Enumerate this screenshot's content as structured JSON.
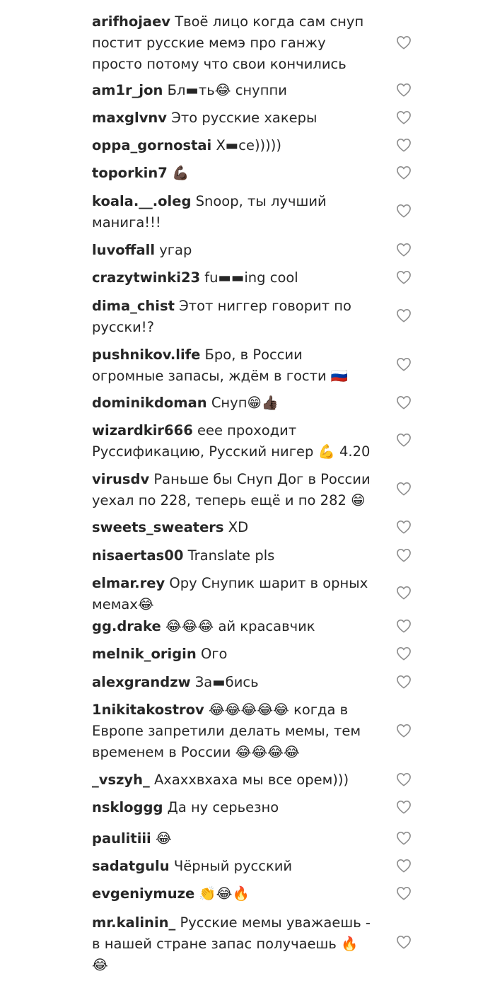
{
  "comments": [
    {
      "username": "arifhojaev",
      "text": "Твоё лицо когда сам снуп постит русские мемэ про ганжу просто потому что свои кончились"
    },
    {
      "username": "am1r_jon",
      "text": "Бл▬ть😂 снуппи"
    },
    {
      "username": "maxglvnv",
      "text": "Это русские хакеры"
    },
    {
      "username": "oppa_gornostai",
      "text": "Х▬се)))))"
    },
    {
      "username": "toporkin7",
      "text": "💪🏿"
    },
    {
      "username": "koala.__.oleg",
      "text": "Snoop, ты лучший манига!!!"
    },
    {
      "username": "luvoffall",
      "text": "угар"
    },
    {
      "username": "crazytwinki23",
      "text": "fu▬▬ing cool"
    },
    {
      "username": "dima_chist",
      "text": "Этот ниггер говорит по русски!?"
    },
    {
      "username": "pushnikov.life",
      "text": "Бро, в России огромные запасы, ждём в гости 🇷🇺"
    },
    {
      "username": "dominikdoman",
      "text": "Снуп😁👍🏿"
    },
    {
      "username": "wizardkir666",
      "text": "еее проходит Руссификацию, Русский нигер 💪 4.20"
    },
    {
      "username": "virusdv",
      "text": "Раньше бы Снуп Дог в России уехал по 228, теперь ещё и по 282 😁"
    },
    {
      "username": "sweets_sweaters",
      "text": "XD"
    },
    {
      "username": "nisaertas00",
      "text": "Translate pls"
    },
    {
      "username": "elmar.rey",
      "text": "Ору Снупик шарит в орных мемах😂"
    },
    {
      "username": "gg.drake",
      "text": "😂😂😂 ай красавчик"
    },
    {
      "username": "melnik_origin",
      "text": "Ого"
    },
    {
      "username": "alexgrandzw",
      "text": "За▬бись"
    },
    {
      "username": "1nikitakostrov",
      "text": "😂😂😂😂😂 когда в Европе запретили делать мемы, тем временем в России 😂😂😂😂"
    },
    {
      "username": "_vszyh_",
      "text": "Ахаххвхаха мы все орем)))"
    },
    {
      "username": "nskloggg",
      "text": "Да ну серьезно"
    },
    {
      "username": "paulitiii",
      "text": "😂"
    },
    {
      "username": "sadatgulu",
      "text": "Чёрный русский"
    },
    {
      "username": "evgeniymuze",
      "text": "👏😂🔥"
    },
    {
      "username": "mr.kalinin_",
      "text": "Русские мемы уважаешь - в нашей стране запас получаешь 🔥 😂"
    }
  ]
}
